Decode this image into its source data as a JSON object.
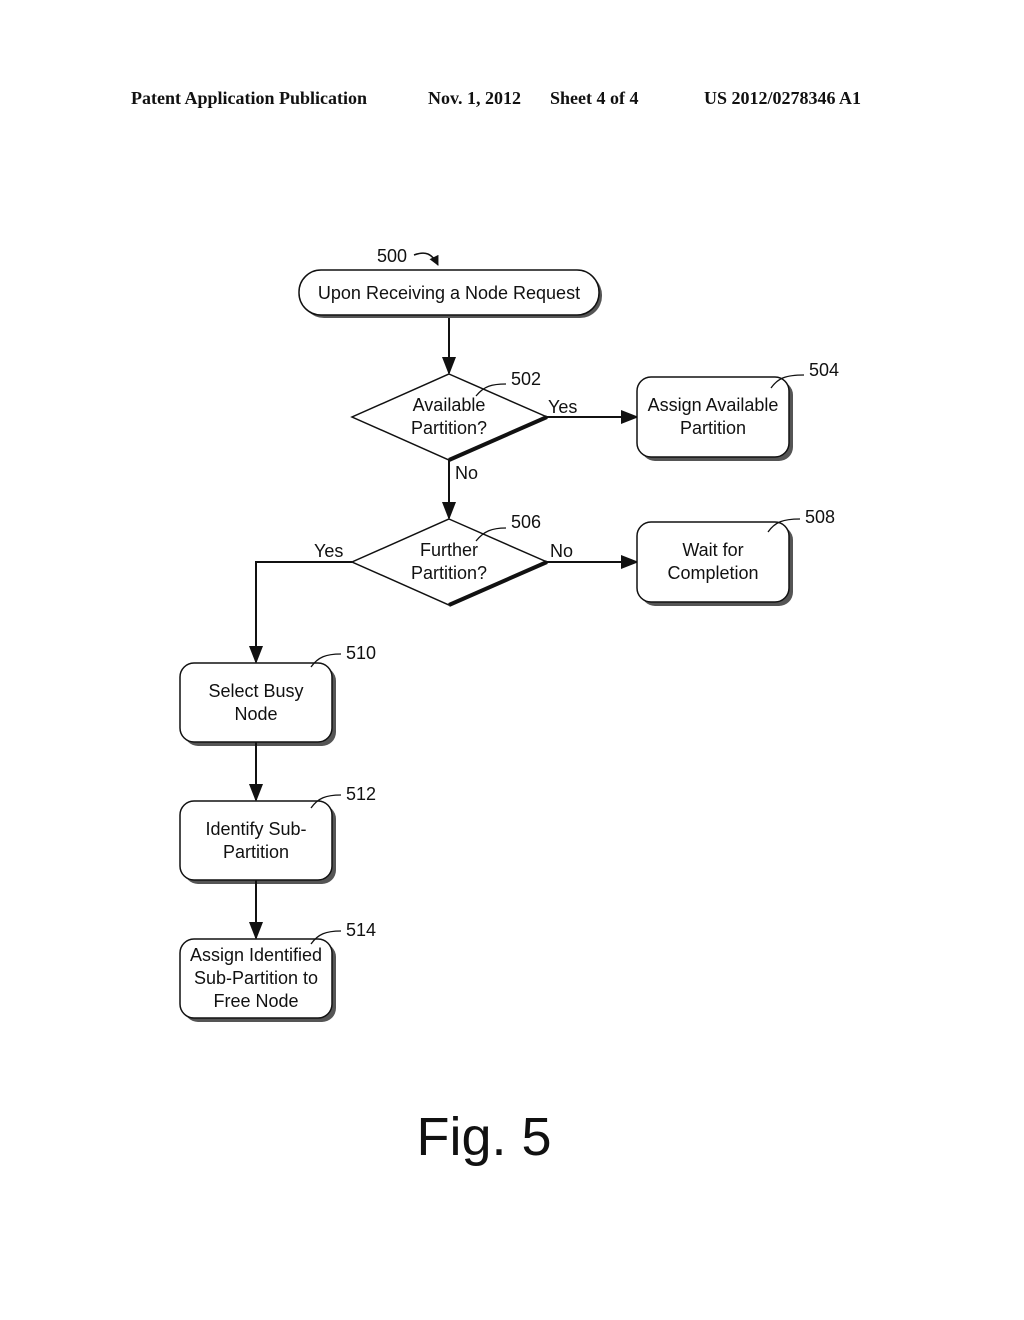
{
  "header": {
    "publication": "Patent Application Publication",
    "date": "Nov. 1, 2012",
    "sheet": "Sheet 4 of 4",
    "number": "US 2012/0278346 A1"
  },
  "figure": {
    "caption": "Fig. 5",
    "flow_ref": "500"
  },
  "nodes": {
    "start": {
      "ref": "500",
      "lines": [
        "Upon Receiving a Node Request"
      ]
    },
    "d502": {
      "ref": "502",
      "lines": [
        "Available",
        "Partition?"
      ]
    },
    "b504": {
      "ref": "504",
      "lines": [
        "Assign Available",
        "Partition"
      ]
    },
    "d506": {
      "ref": "506",
      "lines": [
        "Further",
        "Partition?"
      ]
    },
    "b508": {
      "ref": "508",
      "lines": [
        "Wait for",
        "Completion"
      ]
    },
    "b510": {
      "ref": "510",
      "lines": [
        "Select Busy",
        "Node"
      ]
    },
    "b512": {
      "ref": "512",
      "lines": [
        "Identify Sub-",
        "Partition"
      ]
    },
    "b514": {
      "ref": "514",
      "lines": [
        "Assign Identified",
        "Sub-Partition to",
        "Free Node"
      ]
    }
  },
  "edges": {
    "yes_502": "Yes",
    "no_502": "No",
    "yes_506": "Yes",
    "no_506": "No"
  }
}
